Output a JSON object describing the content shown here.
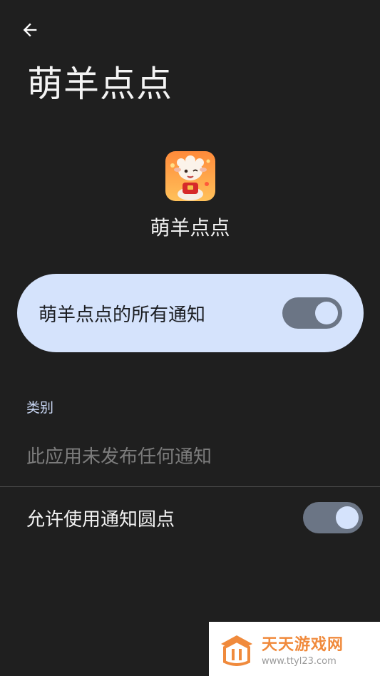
{
  "header": {
    "back_icon": "arrow-left-icon",
    "title": "萌羊点点"
  },
  "app": {
    "icon": "sheep-app-icon",
    "name": "萌羊点点"
  },
  "master_toggle": {
    "label": "萌羊点点的所有通知",
    "checked": true
  },
  "categories": {
    "header": "类别",
    "empty_text": "此应用未发布任何通知"
  },
  "dots_toggle": {
    "label": "允许使用通知圆点",
    "checked": true
  },
  "watermark": {
    "title": "天天游戏网",
    "url": "www.ttyl23.com"
  },
  "colors": {
    "background": "#1f1f1f",
    "card": "#d5e3fc",
    "switch_track": "#6b7585",
    "accent_text": "#c9d7f4",
    "watermark_orange": "#f08a3c"
  }
}
